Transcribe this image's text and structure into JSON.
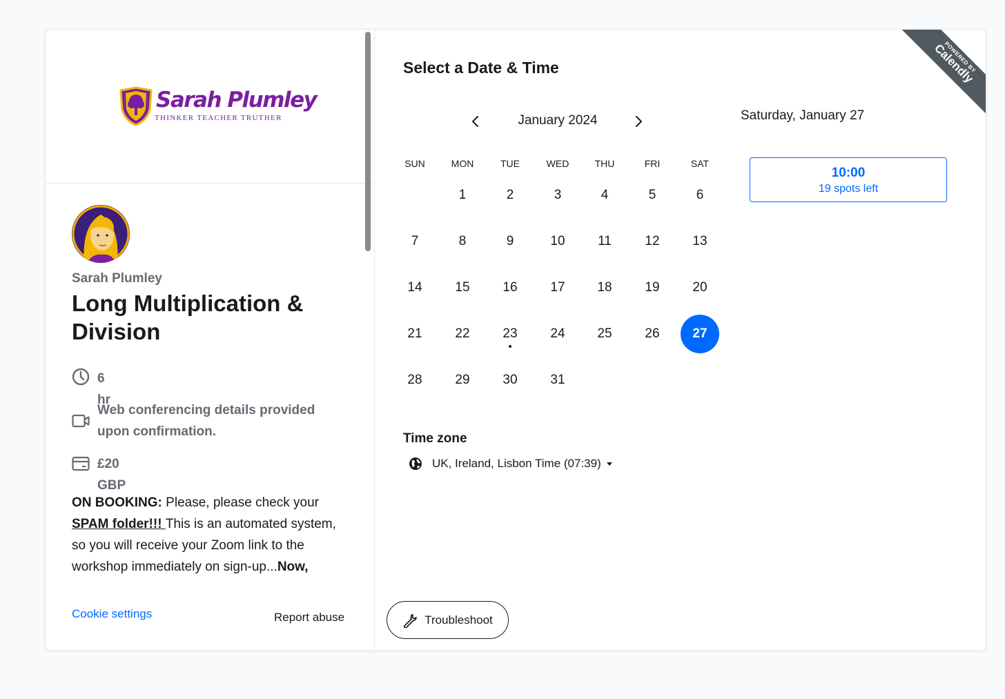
{
  "left": {
    "logo": {
      "name": "Sarah Plumley",
      "tagline": "THINKER TEACHER TRUTHER"
    },
    "host_name": "Sarah Plumley",
    "event_title": "Long Multiplication & Division",
    "details": {
      "duration": "6 hr",
      "location": "Web conferencing details provided upon confirmation.",
      "price": "£20 GBP"
    },
    "description": {
      "lead": "ON BOOKING:",
      "part1": " Please, please check your ",
      "link": "SPAM folder!!! ",
      "part2": "This is an automated system, so you will receive your Zoom link to the workshop immediately on sign-up...",
      "bold_end": "Now,"
    },
    "cookie_settings": "Cookie settings",
    "report_abuse": "Report abuse"
  },
  "main": {
    "title": "Select a Date & Time",
    "month": "January 2024",
    "weekdays": [
      "SUN",
      "MON",
      "TUE",
      "WED",
      "THU",
      "FRI",
      "SAT"
    ],
    "days": [
      "1",
      "2",
      "3",
      "4",
      "5",
      "6",
      "7",
      "8",
      "9",
      "10",
      "11",
      "12",
      "13",
      "14",
      "15",
      "16",
      "17",
      "18",
      "19",
      "20",
      "21",
      "22",
      "23",
      "24",
      "25",
      "26",
      "27",
      "28",
      "29",
      "30",
      "31"
    ],
    "first_weekday_index": 1,
    "selected_day": "27",
    "dot_day": "23",
    "timezone_label": "Time zone",
    "timezone": "UK, Ireland, Lisbon Time (07:39)",
    "selected_date": "Saturday, January 27",
    "slot": {
      "time": "10:00",
      "spots": "19 spots left"
    },
    "troubleshoot": "Troubleshoot"
  },
  "badge": {
    "powered_by": "POWERED BY",
    "brand": "Calendly"
  },
  "colors": {
    "accent": "#0069ff",
    "brand_purple": "#7b1fa2",
    "ribbon": "#505960"
  }
}
